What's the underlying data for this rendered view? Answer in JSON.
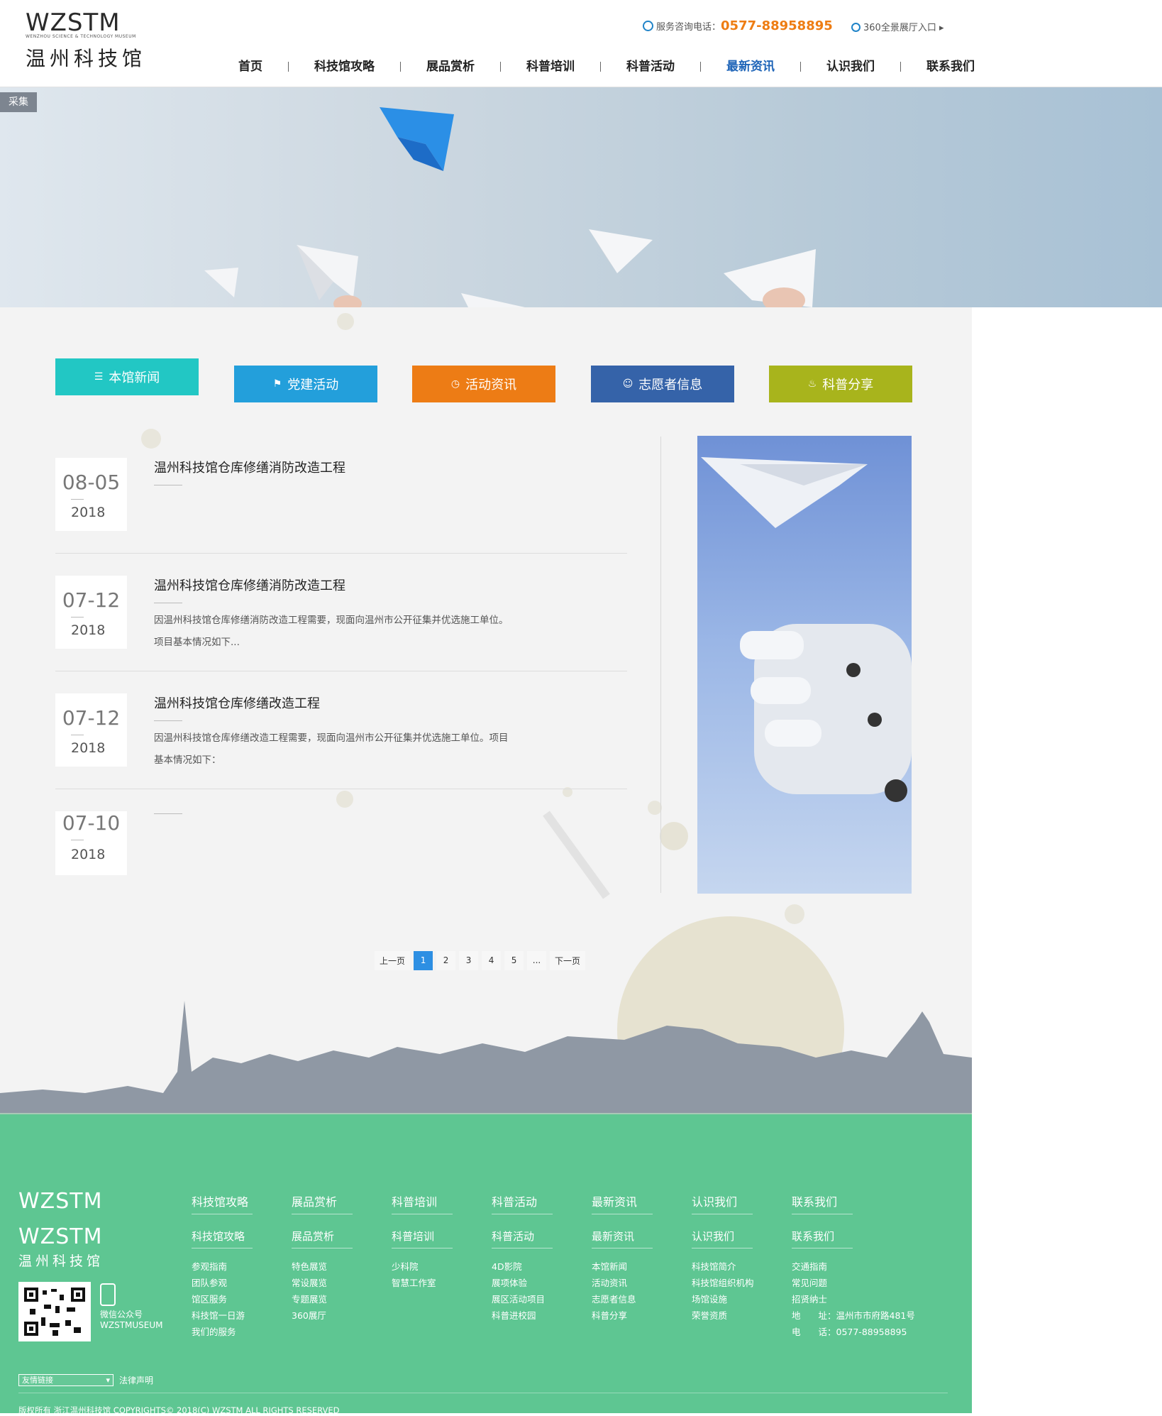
{
  "header": {
    "logo_latin": "WZSTM",
    "logo_sub_left": "WENZHOU SCIENCE & TECHNOLOGY",
    "logo_sub_right": "MUSEUM",
    "logo_cn": "温州科技馆",
    "hotline_label": "服务咨询电话：",
    "hotline_number": "0577-88958895",
    "vr_label": "360全景展厅入口",
    "nav": [
      {
        "label": "首页",
        "active": false
      },
      {
        "label": "科技馆攻略",
        "active": false
      },
      {
        "label": "展品赏析",
        "active": false
      },
      {
        "label": "科普培训",
        "active": false
      },
      {
        "label": "科普活动",
        "active": false
      },
      {
        "label": "最新资讯",
        "active": true
      },
      {
        "label": "认识我们",
        "active": false
      },
      {
        "label": "联系我们",
        "active": false
      }
    ]
  },
  "banner": {
    "collect_tag": "采集"
  },
  "tabs": [
    {
      "label": "本馆新闻",
      "icon": "list-icon",
      "color": "#22c7c4",
      "active": true
    },
    {
      "label": "党建活动",
      "icon": "flag-icon",
      "color": "#239fdb",
      "active": false
    },
    {
      "label": "活动资讯",
      "icon": "clock-icon",
      "color": "#ed7c15",
      "active": false
    },
    {
      "label": "志愿者信息",
      "icon": "user-icon",
      "color": "#3563a9",
      "active": false
    },
    {
      "label": "科普分享",
      "icon": "flame-icon",
      "color": "#a8b41c",
      "active": false
    }
  ],
  "news": [
    {
      "md": "08-05",
      "year": "2018",
      "title": "温州科技馆仓库修缮消防改造工程",
      "summary": ""
    },
    {
      "md": "07-12",
      "year": "2018",
      "title": "温州科技馆仓库修缮消防改造工程",
      "summary": "因温州科技馆仓库修缮消防改造工程需要，现面向温州市公开征集并优选施工单位。项目基本情况如下..."
    },
    {
      "md": "07-12",
      "year": "2018",
      "title": "温州科技馆仓库修缮改造工程",
      "summary": "因温州科技馆仓库修缮改造工程需要，现面向温州市公开征集并优选施工单位。项目基本情况如下："
    },
    {
      "md": "07-10",
      "year": "2018",
      "title": "",
      "summary": ""
    }
  ],
  "pagination": {
    "prev": "上一页",
    "pages": [
      "1",
      "2",
      "3",
      "4",
      "5",
      "..."
    ],
    "current": "1",
    "next": "下一页"
  },
  "footer": {
    "logo_latin": "WZSTM",
    "logo_cn": "温州科技馆",
    "wechat_label": "微信公众号",
    "wechat_id": "WZSTMUSEUM",
    "columns": [
      {
        "head": "科技馆攻略",
        "links": [
          "参观指南",
          "团队参观",
          "馆区服务",
          "科技馆一日游",
          "我们的服务"
        ]
      },
      {
        "head": "展品赏析",
        "links": [
          "特色展览",
          "常设展览",
          "专题展览",
          "360展厅"
        ]
      },
      {
        "head": "科普培训",
        "links": [
          "少科院",
          "智慧工作室"
        ]
      },
      {
        "head": "科普活动",
        "links": [
          "4D影院",
          "展项体验",
          "展区活动项目",
          "科普进校园"
        ]
      },
      {
        "head": "最新资讯",
        "links": [
          "本馆新闻",
          "活动资讯",
          "志愿者信息",
          "科普分享"
        ]
      },
      {
        "head": "认识我们",
        "links": [
          "科技馆简介",
          "科技馆组织机构",
          "场馆设施",
          "荣誉资质"
        ]
      },
      {
        "head": "联系我们",
        "links": [
          "交通指南",
          "常见问题",
          "招贤纳士",
          "地　　址：温州市市府路481号",
          "电　　话：0577-88958895"
        ]
      }
    ],
    "friend_links_label": "友情链接",
    "legal_label": "法律声明",
    "copyright": "版权所有 浙江温州科技馆 COPYRIGHTS© 2018(C) WZSTM ALL RIGHTS RESERVED"
  }
}
